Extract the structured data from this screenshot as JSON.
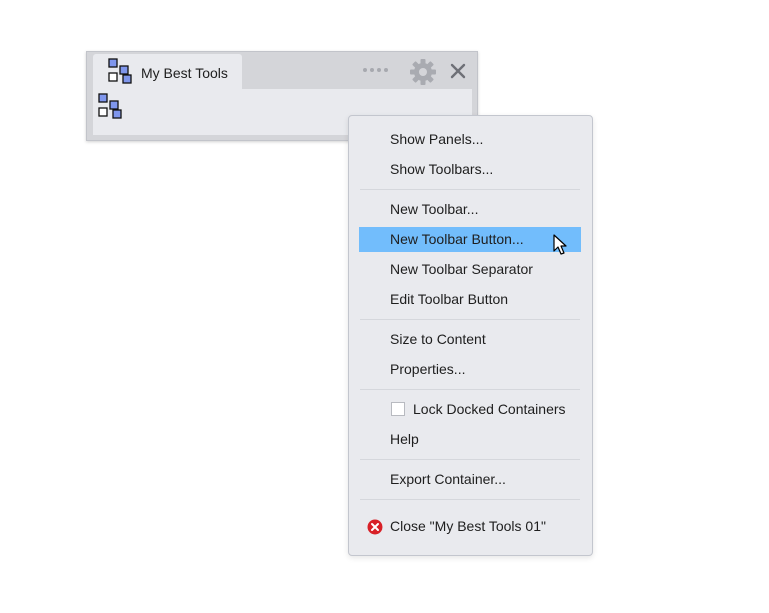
{
  "panel": {
    "tab_label": "My Best Tools",
    "tab_icon": "toolbar-group-icon",
    "body_icon": "toolbar-group-icon",
    "grip_icon": "drag-grip-icon",
    "settings_icon": "gear-icon",
    "close_icon": "close-icon"
  },
  "menu": {
    "items": [
      {
        "label": "Show Panels..."
      },
      {
        "label": "Show Toolbars..."
      },
      {
        "label": "New Toolbar..."
      },
      {
        "label": "New Toolbar Button...",
        "highlighted": true
      },
      {
        "label": "New Toolbar Separator"
      },
      {
        "label": "Edit Toolbar Button"
      },
      {
        "label": "Size to Content"
      },
      {
        "label": "Properties..."
      },
      {
        "label": "Lock Docked Containers",
        "checkbox": true,
        "checked": false
      },
      {
        "label": "Help"
      },
      {
        "label": "Export Container..."
      },
      {
        "label": "Close \"My Best Tools 01\"",
        "icon": "close-circle-icon"
      }
    ]
  },
  "colors": {
    "highlight": "#72bdfc",
    "menu_background": "#e9eaee",
    "panel_background": "#d4d5d9",
    "close_red": "#d82027",
    "icon_blue": "#7f96ec"
  }
}
